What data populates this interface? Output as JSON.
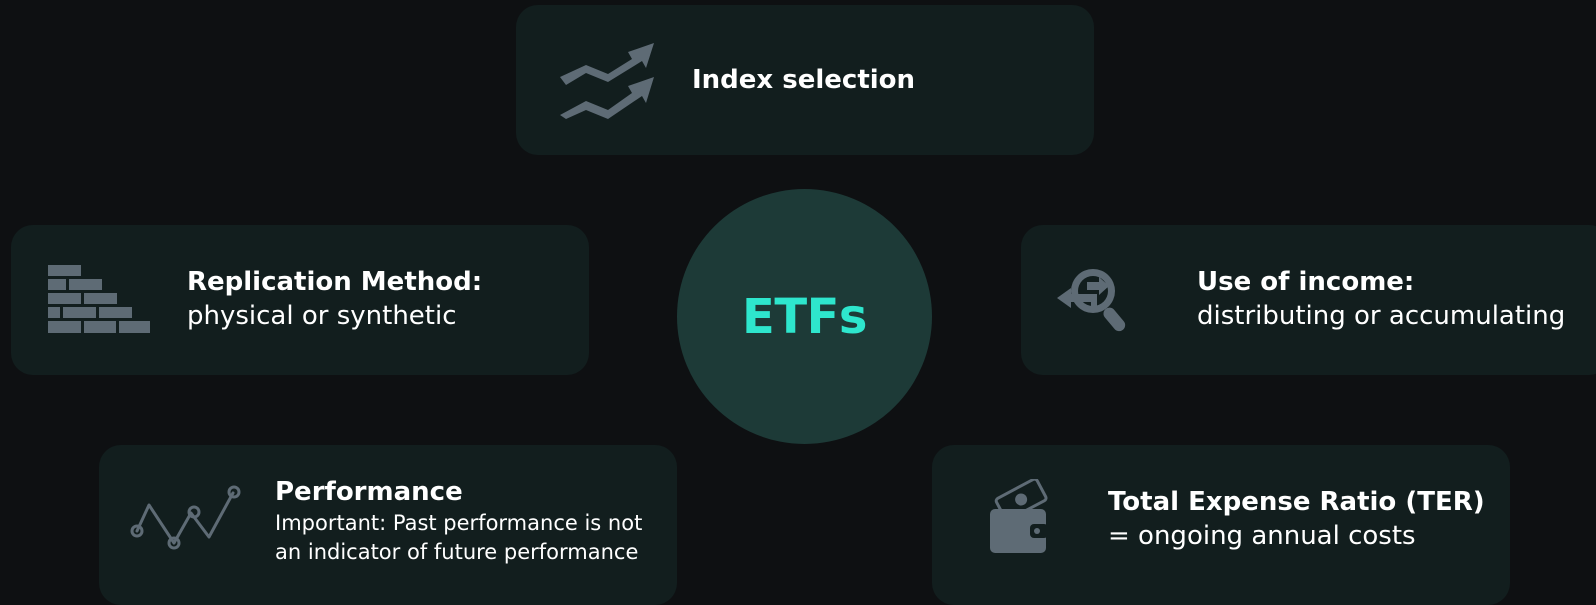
{
  "center": {
    "label": "ETFs",
    "color": "#2ee6cd"
  },
  "colors": {
    "background": "#0e1012",
    "card": "#121e1e",
    "circle": "#1d3a37",
    "icon": "#5e6b75"
  },
  "cards": {
    "index": {
      "icon": "trend-arrows-icon",
      "title": "Index selection"
    },
    "replication": {
      "icon": "brick-wall-icon",
      "title": "Replication Method:",
      "subtitle": "physical or synthetic"
    },
    "income": {
      "icon": "magnifier-arrows-icon",
      "title": "Use of income:",
      "subtitle": "distributing or accumulating"
    },
    "performance": {
      "icon": "line-chart-icon",
      "title": "Performance",
      "lines": [
        "Important: Past performance is not",
        "an indicator of future performance"
      ]
    },
    "ter": {
      "icon": "wallet-cash-icon",
      "title": "Total Expense Ratio (TER)",
      "subtitle": "= ongoing annual costs"
    }
  }
}
